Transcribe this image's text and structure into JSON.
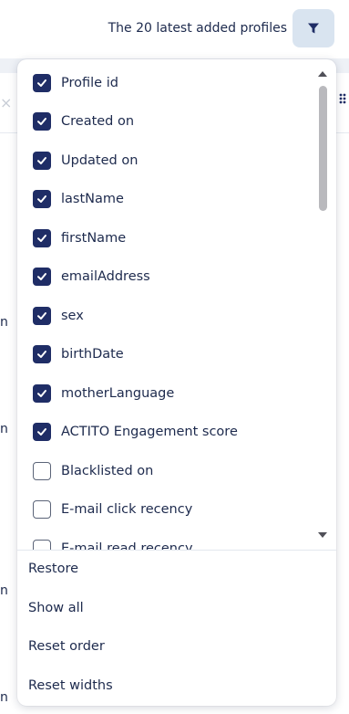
{
  "header": {
    "title": "The 20 latest added profiles",
    "filter_icon": "filter-icon"
  },
  "background": {
    "close_icon": "close-icon",
    "drag_handle_icon": "drag-handle-icon",
    "fragments": [
      "n",
      "n",
      "n",
      "n"
    ]
  },
  "column_picker": {
    "items": [
      {
        "label": "Profile id",
        "checked": true
      },
      {
        "label": "Created on",
        "checked": true
      },
      {
        "label": "Updated on",
        "checked": true
      },
      {
        "label": "lastName",
        "checked": true
      },
      {
        "label": "firstName",
        "checked": true
      },
      {
        "label": "emailAddress",
        "checked": true
      },
      {
        "label": "sex",
        "checked": true
      },
      {
        "label": "birthDate",
        "checked": true
      },
      {
        "label": "motherLanguage",
        "checked": true
      },
      {
        "label": "ACTITO Engagement score",
        "checked": true
      },
      {
        "label": "Blacklisted on",
        "checked": false
      },
      {
        "label": "E-mail click recency",
        "checked": false
      },
      {
        "label": "E-mail read recency",
        "checked": false
      }
    ],
    "actions": {
      "restore": "Restore",
      "show_all": "Show all",
      "reset_order": "Reset order",
      "reset_widths": "Reset widths"
    }
  },
  "colors": {
    "accent": "#1f2d66",
    "filter_button_bg": "#d9e4f0",
    "text": "#1d2a4d"
  }
}
